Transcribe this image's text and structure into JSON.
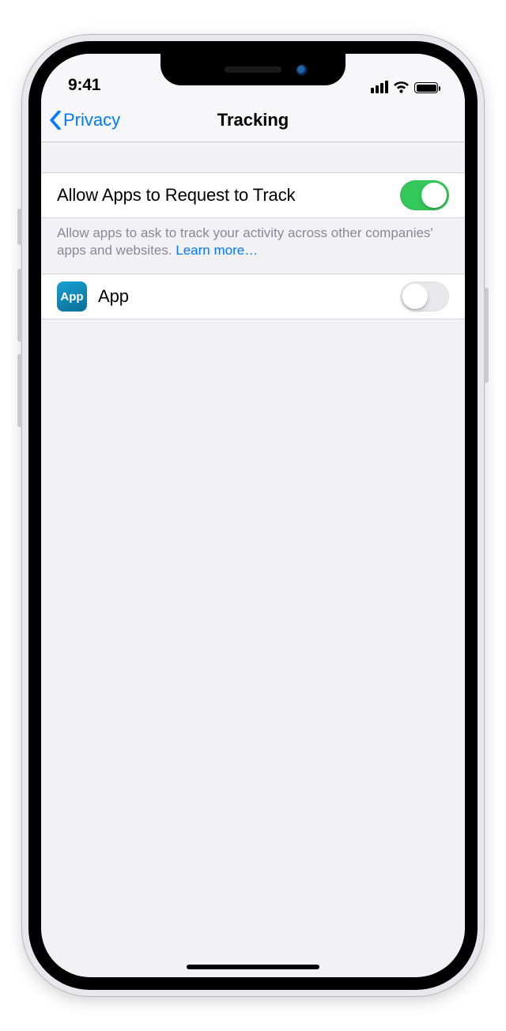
{
  "status": {
    "time": "9:41"
  },
  "nav": {
    "back_label": "Privacy",
    "title": "Tracking"
  },
  "rows": {
    "allow": {
      "label": "Allow Apps to Request to Track",
      "on": true
    },
    "app": {
      "label": "App",
      "icon_text": "App",
      "on": false
    }
  },
  "footer": {
    "text": "Allow apps to ask to track your activity across other companies' apps and websites. ",
    "learn_more": "Learn more…"
  }
}
